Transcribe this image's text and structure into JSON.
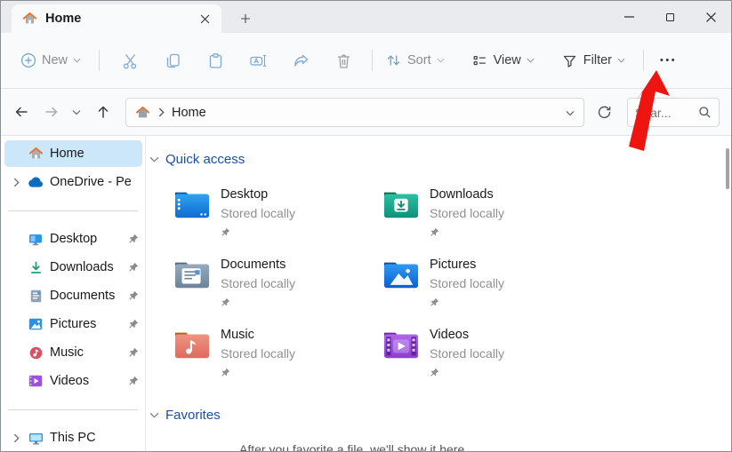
{
  "tab_bar": {
    "tab_label": "Home"
  },
  "window_controls": {
    "buttons": [
      "minimize",
      "maximize",
      "close"
    ]
  },
  "toolbar": {
    "new_label": "New",
    "sort_label": "Sort",
    "view_label": "View",
    "filter_label": "Filter",
    "more_label": "•••",
    "icon_buttons": [
      "cut",
      "copy",
      "paste",
      "rename",
      "share",
      "delete"
    ]
  },
  "address_bar": {
    "breadcrumb_root": "Home",
    "search_text": "Sear...",
    "nav": [
      "back",
      "forward",
      "recent-locations",
      "up"
    ]
  },
  "sidebar": {
    "items": [
      {
        "label": "Home",
        "icon": "home",
        "selected": true
      },
      {
        "label": "OneDrive - Pe",
        "icon": "onedrive",
        "expandable": true
      },
      {
        "label": "Desktop",
        "icon": "desktop",
        "pinned": true
      },
      {
        "label": "Downloads",
        "icon": "downloads",
        "pinned": true
      },
      {
        "label": "Documents",
        "icon": "documents",
        "pinned": true
      },
      {
        "label": "Pictures",
        "icon": "pictures",
        "pinned": true
      },
      {
        "label": "Music",
        "icon": "music",
        "pinned": true
      },
      {
        "label": "Videos",
        "icon": "videos",
        "pinned": true
      },
      {
        "label": "This PC",
        "icon": "this-pc",
        "expandable": true
      }
    ]
  },
  "content": {
    "quick_access": {
      "title": "Quick access",
      "items": [
        {
          "name": "Desktop",
          "status": "Stored locally",
          "pinned": true
        },
        {
          "name": "Downloads",
          "status": "Stored locally",
          "pinned": true
        },
        {
          "name": "Documents",
          "status": "Stored locally",
          "pinned": true
        },
        {
          "name": "Pictures",
          "status": "Stored locally",
          "pinned": true
        },
        {
          "name": "Music",
          "status": "Stored locally",
          "pinned": true
        },
        {
          "name": "Videos",
          "status": "Stored locally",
          "pinned": true
        }
      ]
    },
    "favorites": {
      "title": "Favorites",
      "empty_hint": "After you favorite a file, we'll show it here"
    }
  },
  "annotation": {
    "shape": "red-arrow",
    "points_to": "see-more-button",
    "color": "#ee1410"
  },
  "colors": {
    "accent_header_blue": "#1c4da9",
    "selection_blue": "#cce7fa",
    "titlebar_gray": "#e9ebee",
    "chrome_gray": "#f9fafb",
    "annotation_red": "#ee1410"
  },
  "icons": {
    "new": "plus-circle",
    "sort": "up-down-arrows",
    "view": "list-details",
    "filter": "funnel",
    "more": "ellipsis",
    "search": "magnifier",
    "refresh": "circular-arrow",
    "pin": "pushpin"
  }
}
